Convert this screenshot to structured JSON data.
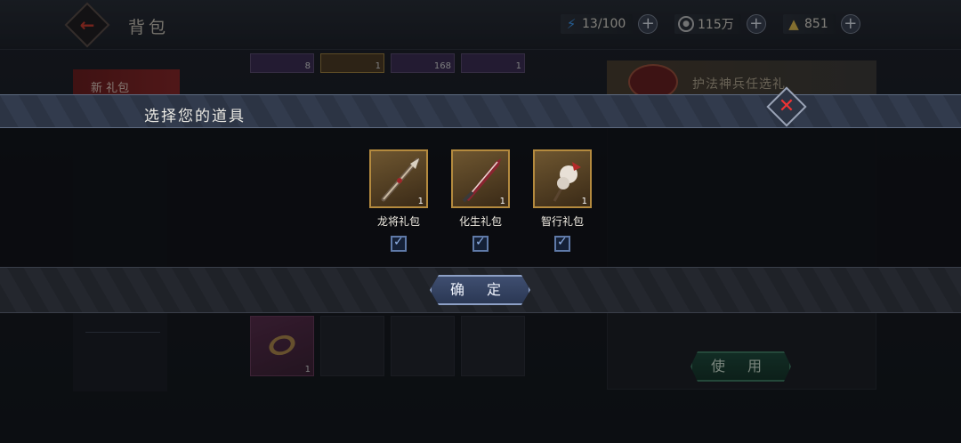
{
  "header": {
    "title": "背包",
    "energy": "13/100",
    "coins": "115万",
    "gold": "851"
  },
  "bag": {
    "tab_label": "新 礼包",
    "top_counts": [
      "8",
      "1",
      "168",
      "1"
    ],
    "bottom_item_count": "1",
    "detail_title": "护法神兵任选礼",
    "use_label": "使 用"
  },
  "modal": {
    "title": "选择您的道具",
    "confirm_label": "确 定",
    "items": [
      {
        "label": "龙将礼包",
        "count": "1",
        "checked": true
      },
      {
        "label": "化生礼包",
        "count": "1",
        "checked": true
      },
      {
        "label": "智行礼包",
        "count": "1",
        "checked": true
      }
    ]
  },
  "colors": {
    "accent_gold": "#b48a3e",
    "confirm_blue": "#3f4e70",
    "use_green": "#1c4a3a",
    "close_red": "#ee3333"
  }
}
